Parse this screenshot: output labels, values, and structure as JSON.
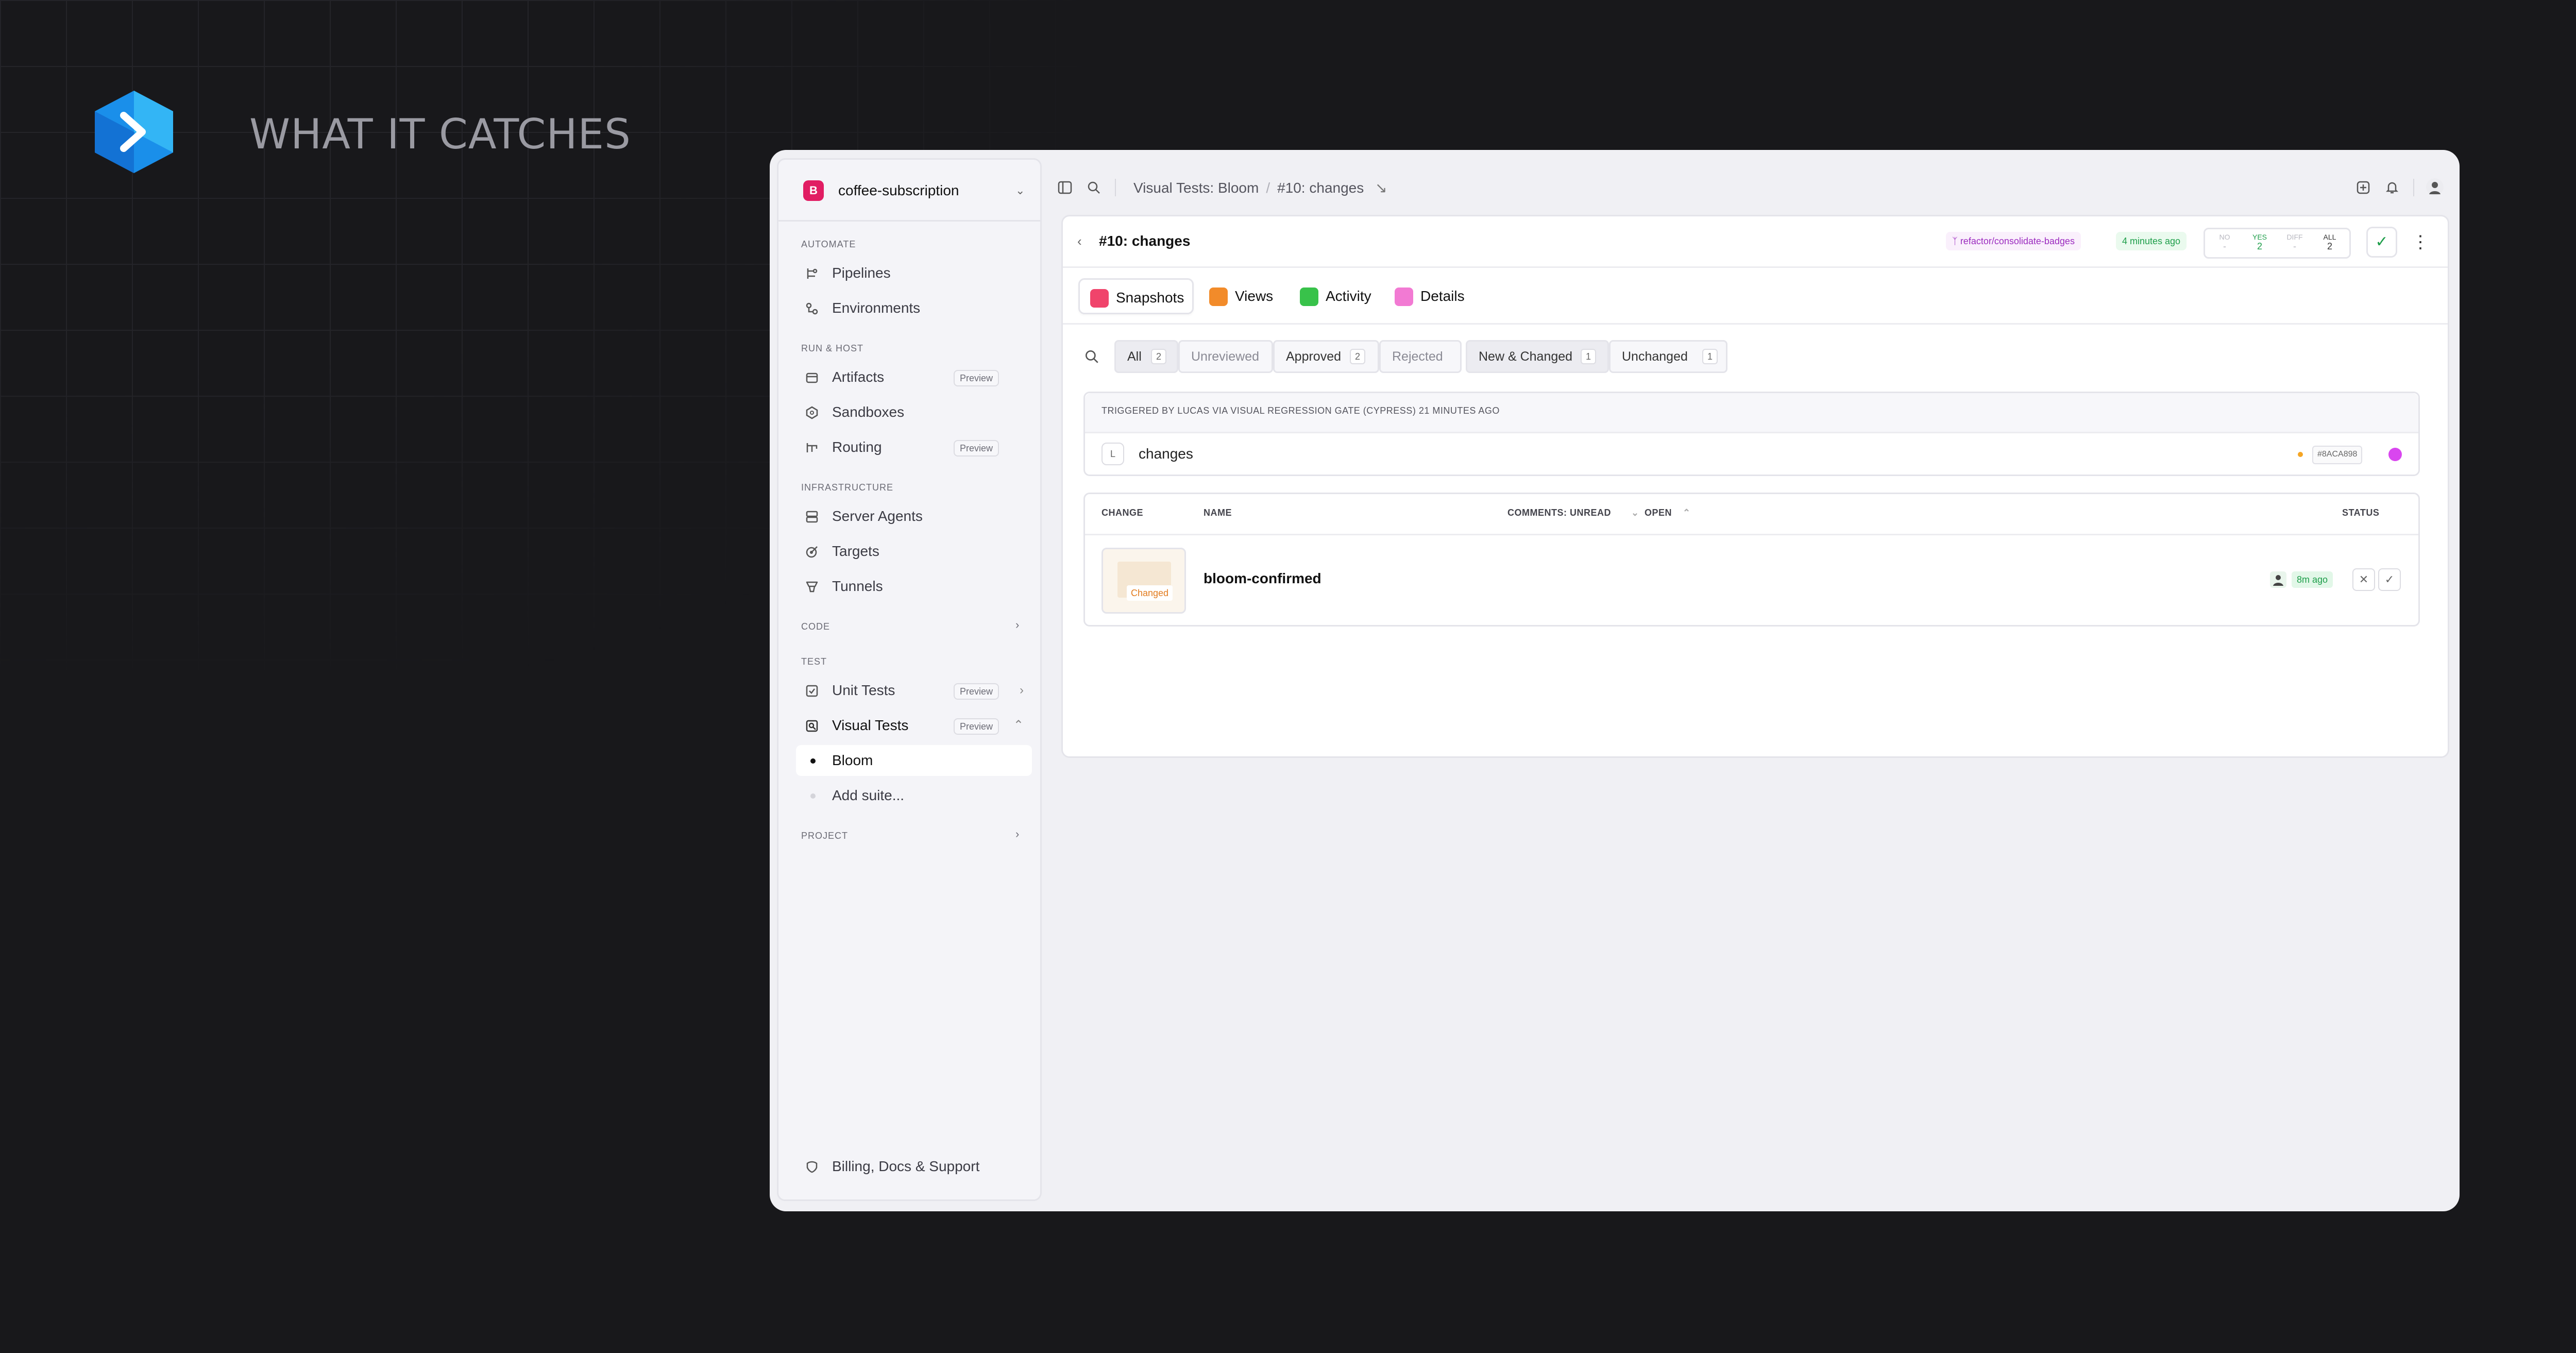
{
  "headline": "WHAT IT CATCHES",
  "project": {
    "badge": "B",
    "name": "coffee-subscription"
  },
  "sidebar": {
    "sections": {
      "automate": "AUTOMATE",
      "run_host": "RUN & HOST",
      "infrastructure": "INFRASTRUCTURE",
      "code": "CODE",
      "test": "TEST",
      "project": "PROJECT"
    },
    "items": {
      "pipelines": "Pipelines",
      "environments": "Environments",
      "artifacts": "Artifacts",
      "sandboxes": "Sandboxes",
      "routing": "Routing",
      "server_agents": "Server Agents",
      "targets": "Targets",
      "tunnels": "Tunnels",
      "unit_tests": "Unit Tests",
      "visual_tests": "Visual Tests",
      "bloom": "Bloom",
      "add_suite": "Add suite..."
    },
    "preview_label": "Preview",
    "footer": "Billing, Docs & Support"
  },
  "breadcrumb": {
    "parent": "Visual Tests: Bloom",
    "current": "#10: changes",
    "sep": "/"
  },
  "build": {
    "title": "#10: changes",
    "branch": "refactor/consolidate-badges",
    "time": "4 minutes ago",
    "stats": [
      {
        "key": "NO",
        "value": "-"
      },
      {
        "key": "YES",
        "value": "2"
      },
      {
        "key": "DIFF",
        "value": "-"
      },
      {
        "key": "ALL",
        "value": "2"
      }
    ]
  },
  "tabs": [
    "Snapshots",
    "Views",
    "Activity",
    "Details"
  ],
  "filters": {
    "all": {
      "label": "All",
      "count": "2"
    },
    "unreviewed": {
      "label": "Unreviewed"
    },
    "approved": {
      "label": "Approved",
      "count": "2"
    },
    "rejected": {
      "label": "Rejected"
    },
    "new_changed": {
      "label": "New & Changed",
      "count": "1"
    },
    "unchanged": {
      "label": "Unchanged",
      "count": "1"
    }
  },
  "trigger": {
    "text": "TRIGGERED BY LUCAS VIA VISUAL REGRESSION GATE (CYPRESS) 21 MINUTES AGO",
    "avatar": "L",
    "name": "changes",
    "hash": "#8ACA898"
  },
  "table": {
    "headers": {
      "change": "CHANGE",
      "name": "NAME",
      "comments": "COMMENTS: UNREAD",
      "open": "OPEN",
      "status": "STATUS"
    },
    "rows": [
      {
        "tag": "Changed",
        "name": "bloom-confirmed",
        "time": "8m ago"
      }
    ]
  },
  "colors": {
    "brand": "#e11d63",
    "approved": "#1e9e4a",
    "branch": "#9b2bbf",
    "changed": "#e27b1e"
  }
}
